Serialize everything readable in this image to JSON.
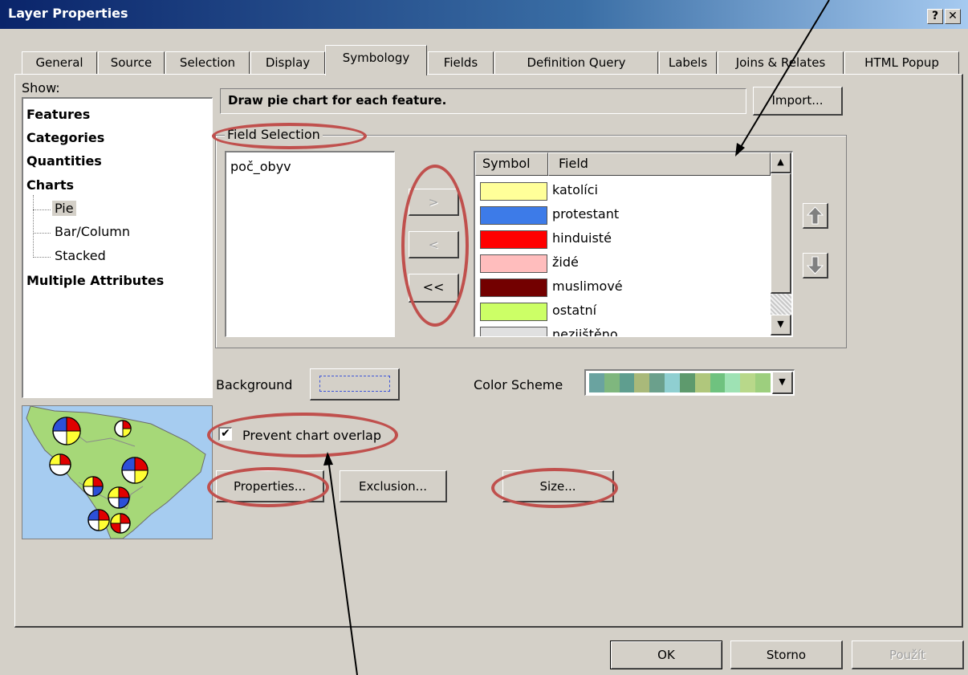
{
  "window": {
    "title": "Layer Properties",
    "help_btn": "?",
    "close_btn": "✕"
  },
  "tabs": [
    "General",
    "Source",
    "Selection",
    "Display",
    "Symbology",
    "Fields",
    "Definition Query",
    "Labels",
    "Joins & Relates",
    "HTML Popup"
  ],
  "active_tab": "Symbology",
  "show": {
    "label": "Show:",
    "items": [
      "Features",
      "Categories",
      "Quantities",
      "Charts"
    ],
    "sub_items": [
      "Pie",
      "Bar/Column",
      "Stacked"
    ],
    "selected": "Pie",
    "last": "Multiple Attributes"
  },
  "description": "Draw pie chart for each feature.",
  "import_label": "Import...",
  "field_selection": {
    "label": "Field Selection",
    "available": [
      "poč_obyv"
    ],
    "move_right": ">",
    "move_left": "<",
    "move_all_left": "<<",
    "columns": {
      "symbol": "Symbol",
      "field": "Field"
    },
    "fields": [
      {
        "name": "katolíci",
        "color": "#ffff99"
      },
      {
        "name": "protestant",
        "color": "#3d7be8"
      },
      {
        "name": "hinduisté",
        "color": "#ff0000"
      },
      {
        "name": "židé",
        "color": "#ffbdbd"
      },
      {
        "name": "muslimové",
        "color": "#730000"
      },
      {
        "name": "ostatní",
        "color": "#ccff66"
      },
      {
        "name": "nezjištěno",
        "color": "#e0e0e0"
      }
    ]
  },
  "background_label": "Background",
  "color_scheme_label": "Color Scheme",
  "color_scheme": [
    "#6aa3a0",
    "#7fb77e",
    "#5f9e8f",
    "#a9b97a",
    "#6ba08c",
    "#8fcfd1",
    "#5e9a6d",
    "#b0c77c",
    "#6fc27f",
    "#9ee2b4",
    "#b8d88a",
    "#9dcf7e"
  ],
  "prevent_overlap": {
    "label": "Prevent chart overlap",
    "checked": true
  },
  "buttons": {
    "properties": "Properties...",
    "exclusion": "Exclusion...",
    "size": "Size...",
    "ok": "OK",
    "cancel": "Storno",
    "apply": "Použít"
  },
  "colors": {
    "title_bar": "#0a246a",
    "dialog_bg": "#d4d0c8",
    "annotation": "#c0504d"
  }
}
